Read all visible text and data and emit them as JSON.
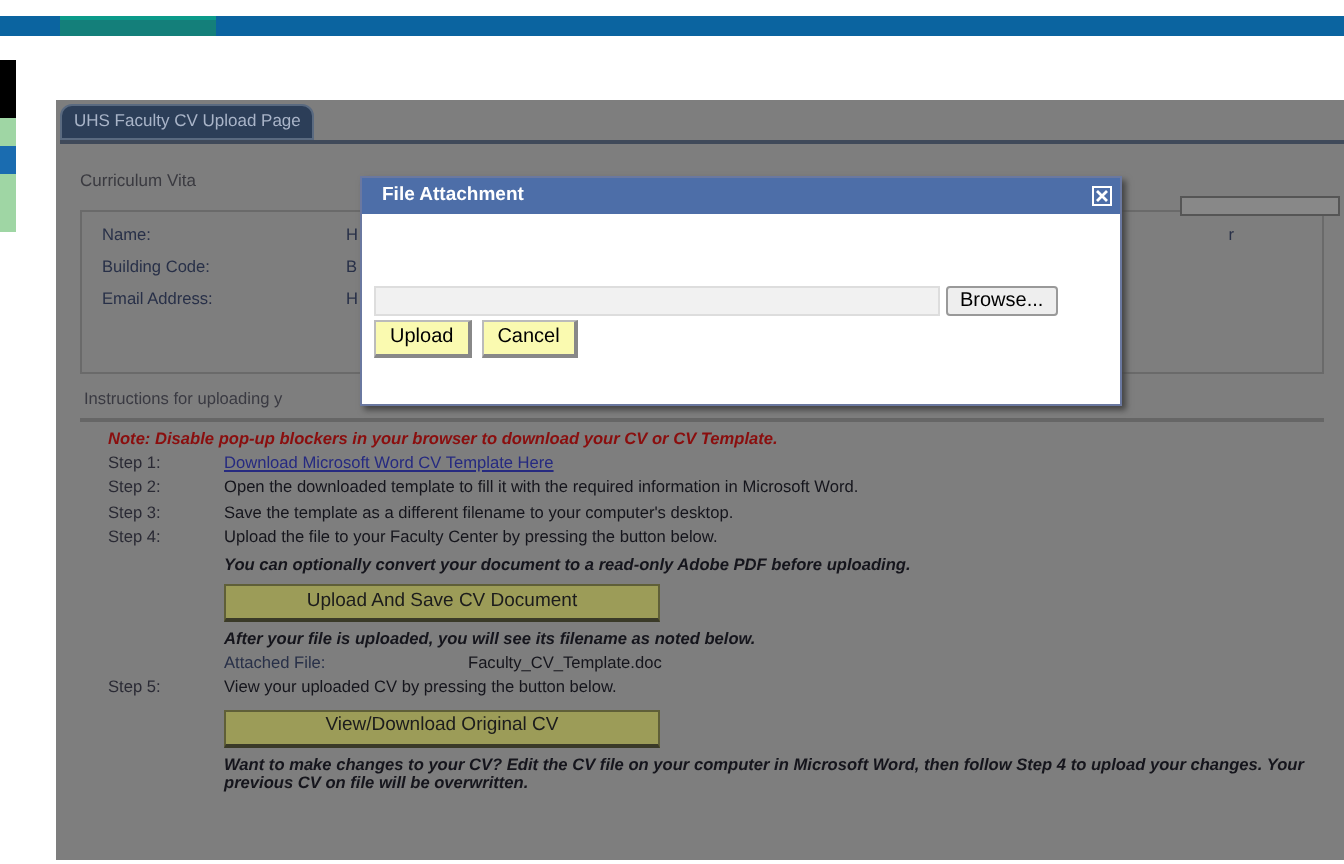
{
  "tab": {
    "label": "UHS Faculty CV Upload Page",
    "selected": true
  },
  "section_title": "Curriculum Vita",
  "info_rows": [
    {
      "label": "Name:",
      "value": "H",
      "trailing": "r"
    },
    {
      "label": "Building Code:",
      "value": "B"
    },
    {
      "label": "Email Address:",
      "value": "H"
    }
  ],
  "instructions_heading": "Instructions for uploading y",
  "note": "Note: Disable pop-up blockers in your browser to download your CV or CV Template.",
  "steps": [
    {
      "kind": "link",
      "label": "Step 1:",
      "text": "Download Microsoft Word CV Template Here"
    },
    {
      "kind": "step",
      "label": "Step 2:",
      "text": "Open the downloaded template to fill it with the required information in Microsoft Word."
    },
    {
      "kind": "step",
      "label": "Step 3:",
      "text": "Save the template as a different filename to your computer's desktop."
    },
    {
      "kind": "step",
      "label": "Step 4:",
      "text": "Upload the file to your Faculty Center by pressing the button below."
    },
    {
      "kind": "hint",
      "text": "You can optionally convert your document to a read-only Adobe PDF before uploading."
    },
    {
      "kind": "button",
      "text": "Upload And Save CV Document"
    },
    {
      "kind": "hint",
      "text": "After your file is uploaded, you will see its filename as noted below."
    },
    {
      "kind": "file",
      "label": "Attached File:",
      "text": "Faculty_CV_Template.doc"
    },
    {
      "kind": "step",
      "label": "Step 5:",
      "text": "View your uploaded CV by pressing the button below."
    },
    {
      "kind": "button",
      "text": "View/Download Original CV"
    },
    {
      "kind": "hint",
      "text": "Want to make changes to your CV? Edit the CV file on your computer in Microsoft Word, then follow Step 4 to upload your changes. Your previous CV on file will be overwritten."
    }
  ],
  "dialog": {
    "title": "File Attachment",
    "browse_label": "Browse...",
    "buttons": [
      "Upload",
      "Cancel"
    ]
  }
}
